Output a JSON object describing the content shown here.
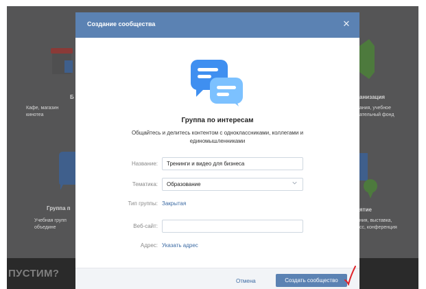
{
  "background": {
    "left_cards": [
      {
        "title": "Б",
        "subtitle": "Кафе, магазин\nкинотеа"
      },
      {
        "title": "Группа п",
        "subtitle": "Учебная групп\nобъедине"
      }
    ],
    "right_cards": [
      {
        "title": "анизация",
        "subtitle": "ания, учебное\nательный фонд"
      },
      {
        "title": "ятие",
        "subtitle": "ния, выставка,\nсс, конференция"
      }
    ],
    "promo_text": "ПУСТИМ?"
  },
  "modal": {
    "title": "Создание сообщества",
    "group_type": {
      "title": "Группа по интересам",
      "description": "Общайтесь и делитесь контентом с одноклассниками, коллегами и единомышленниками"
    },
    "form": {
      "name_label": "Название:",
      "name_value": "Тренинги и видео для бизнеса",
      "topic_label": "Тематика:",
      "topic_value": "Образование",
      "group_kind_label": "Тип группы:",
      "group_kind_value": "Закрытая",
      "website_label": "Веб-сайт:",
      "website_value": "",
      "address_label": "Адрес:",
      "address_link": "Указать адрес"
    },
    "footer": {
      "cancel_label": "Отмена",
      "create_label": "Создать сообщество"
    }
  },
  "colors": {
    "header_blue": "#5b82b3",
    "link_blue": "#3b6aa3",
    "accent_red": "#e0242a"
  }
}
